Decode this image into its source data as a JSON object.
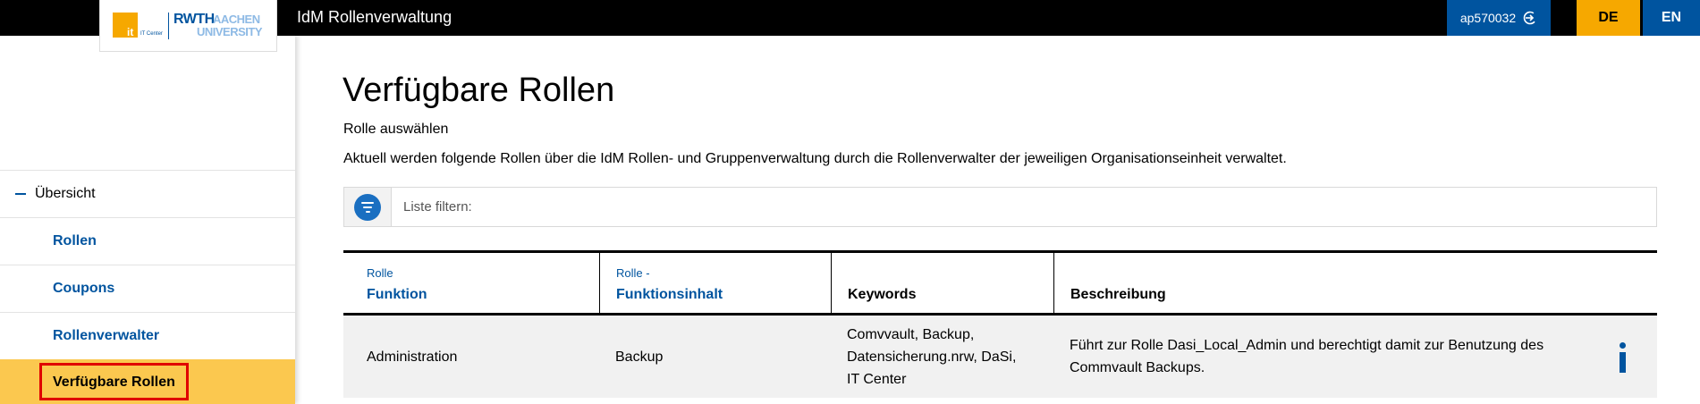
{
  "header": {
    "app_title": "IdM Rollenverwaltung",
    "user": "ap570032",
    "lang_de": "DE",
    "lang_en": "EN"
  },
  "logo": {
    "it": "it",
    "it_center": "IT Center",
    "rwth": "RWTH",
    "aachen": "AACHEN",
    "university": "UNIVERSITY"
  },
  "sidebar": {
    "overview": "Übersicht",
    "items": [
      "Rollen",
      "Coupons",
      "Rollenverwalter",
      "Verfügbare Rollen"
    ]
  },
  "main": {
    "title": "Verfügbare Rollen",
    "subtitle": "Rolle auswählen",
    "description": "Aktuell werden folgende Rollen über die IdM Rollen- und Gruppenverwaltung durch die Rollenverwalter der jeweiligen Organisationseinheit verwaltet.",
    "filter_placeholder": "Liste filtern:"
  },
  "table": {
    "columns": [
      {
        "small": "Rolle",
        "big": "Funktion"
      },
      {
        "small": "Rolle -",
        "big": "Funktionsinhalt"
      },
      {
        "big": "Keywords"
      },
      {
        "big": "Beschreibung"
      }
    ],
    "rows": [
      {
        "funktion": "Administration",
        "inhalt": "Backup",
        "keywords": [
          "Comvvault, Backup,",
          "Datensicherung.nrw, DaSi,",
          "IT Center"
        ],
        "beschreibung": [
          "Führt zur Rolle Dasi_Local_Admin und berechtigt damit zur Benutzung des",
          "Commvault Backups."
        ]
      }
    ]
  },
  "colors": {
    "brand_blue": "#00549f",
    "brand_yellow": "#f6a800",
    "active_bg": "#fbc84f",
    "highlight_red": "#e00000"
  },
  "icons": [
    "logout-icon",
    "filter-icon",
    "info-icon"
  ]
}
